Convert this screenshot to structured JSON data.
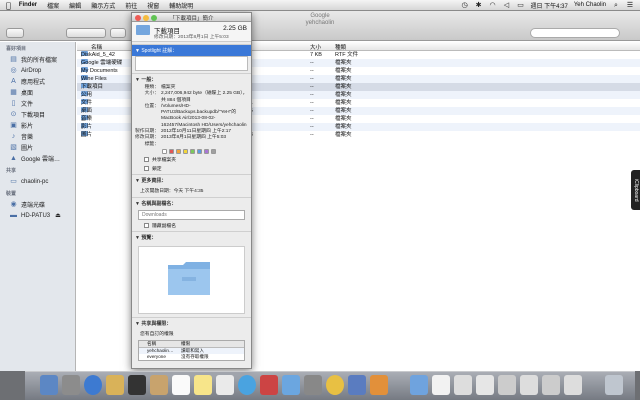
{
  "menubar": {
    "app": "Finder",
    "menus": [
      "檔案",
      "編輯",
      "顯示方式",
      "前往",
      "視窗",
      "輔助說明"
    ],
    "clock": "週日 下午4:37",
    "user": "Yeh Chaolin"
  },
  "finder": {
    "window_title": "Google",
    "path_title": "yehchaolin",
    "sidebar": {
      "favorites_header": "喜好項目",
      "favorites": [
        {
          "label": "我的所有檔案",
          "icon": "all-files-icon"
        },
        {
          "label": "AirDrop",
          "icon": "airdrop-icon"
        },
        {
          "label": "應用程式",
          "icon": "applications-icon"
        },
        {
          "label": "桌面",
          "icon": "desktop-icon"
        },
        {
          "label": "文件",
          "icon": "documents-icon"
        },
        {
          "label": "下載項目",
          "icon": "downloads-icon"
        },
        {
          "label": "影片",
          "icon": "movies-icon"
        },
        {
          "label": "音樂",
          "icon": "music-icon"
        },
        {
          "label": "圖片",
          "icon": "pictures-icon"
        },
        {
          "label": "Google 雲端…",
          "icon": "google-drive-icon"
        }
      ],
      "shared_header": "共享",
      "shared": [
        {
          "label": "chaolin-pc",
          "icon": "pc-icon"
        }
      ],
      "devices_header": "裝置",
      "devices": [
        {
          "label": "遠端光碟",
          "icon": "remote-disc-icon"
        },
        {
          "label": "HD-PATU3",
          "icon": "external-drive-icon"
        }
      ]
    },
    "columns": {
      "name": "名稱",
      "size": "大小",
      "kind": "種類"
    },
    "rows": [
      {
        "name": "DiskAid_5_42",
        "time": "5:48",
        "size": "7 KB",
        "kind": "RTF 文件"
      },
      {
        "name": "Google 雲端硬碟",
        "time": "1:32",
        "size": "--",
        "kind": "檔案夾"
      },
      {
        "name": "My Documents",
        "time": "9:13",
        "size": "--",
        "kind": "檔案夾"
      },
      {
        "name": "Wine Files",
        "time": "4:00",
        "size": "--",
        "kind": "檔案夾"
      },
      {
        "name": "下載項目",
        "time": "5:03",
        "size": "--",
        "kind": "檔案夾"
      },
      {
        "name": "公用",
        "time": "6:33",
        "size": "--",
        "kind": "檔案夾"
      },
      {
        "name": "文件",
        "time": "10:01",
        "size": "--",
        "kind": "檔案夾"
      },
      {
        "name": "桌面",
        "time": "12:35",
        "size": "--",
        "kind": "檔案夾"
      },
      {
        "name": "音樂",
        "time": "4:23",
        "size": "--",
        "kind": "檔案夾"
      },
      {
        "name": "影片",
        "time": "1:00",
        "size": "--",
        "kind": "檔案夾"
      },
      {
        "name": "圖片",
        "time": "10:13",
        "size": "--",
        "kind": "檔案夾"
      }
    ]
  },
  "info": {
    "title": "「下載項目」簡介",
    "name": "下載項目",
    "size": "2.25 GB",
    "modified": "修改日期：2013年8月1日 上午5:03",
    "spotlight_label": "Spotlight 註解：",
    "general_label": "一般：",
    "general": [
      {
        "k": "種類：",
        "v": "檔案夾"
      },
      {
        "k": "大小：",
        "v": "2,247,006,942 byte（磁碟上 2.25 GB），共 884 個項目"
      },
      {
        "k": "位置：",
        "v": "/Volumes/HD-PATU3/Backups.backupdb/\"YeH\"的 MacBook Air/2013-08-02-162457/Macintosh HD/Users/yehchaolin"
      },
      {
        "k": "製作日期：",
        "v": "2012年10月11日星期四 上午2:17"
      },
      {
        "k": "修改日期：",
        "v": "2013年8月1日星期四 上午5:03"
      },
      {
        "k": "標籤：",
        "v": ""
      }
    ],
    "tag_colors": [
      "#ffffff",
      "#e05656",
      "#f2a33a",
      "#f2d63a",
      "#7cc95c",
      "#5a9be0",
      "#a877d6",
      "#a0a0a0"
    ],
    "shared_folder": "共享檔案夾",
    "locked": "鎖定",
    "more_info_label": "更多資訊：",
    "last_opened": "上次開啟日期：今天 下午4:35",
    "name_ext_label": "名稱與副檔名：",
    "name_value": "Downloads",
    "hide_ext": "隱藏副檔名",
    "preview_label": "預覽：",
    "sharing_label": "共享與權限：",
    "sharing_desc": "您有自訂的權限",
    "perm_head": {
      "name": "名稱",
      "priv": "權限"
    },
    "perms": [
      {
        "name": "yehchaolin…",
        "priv": "讀取和寫入"
      },
      {
        "name": "everyone",
        "priv": "沒有存取權限"
      }
    ]
  },
  "clipboard_tab": "iClipboard"
}
